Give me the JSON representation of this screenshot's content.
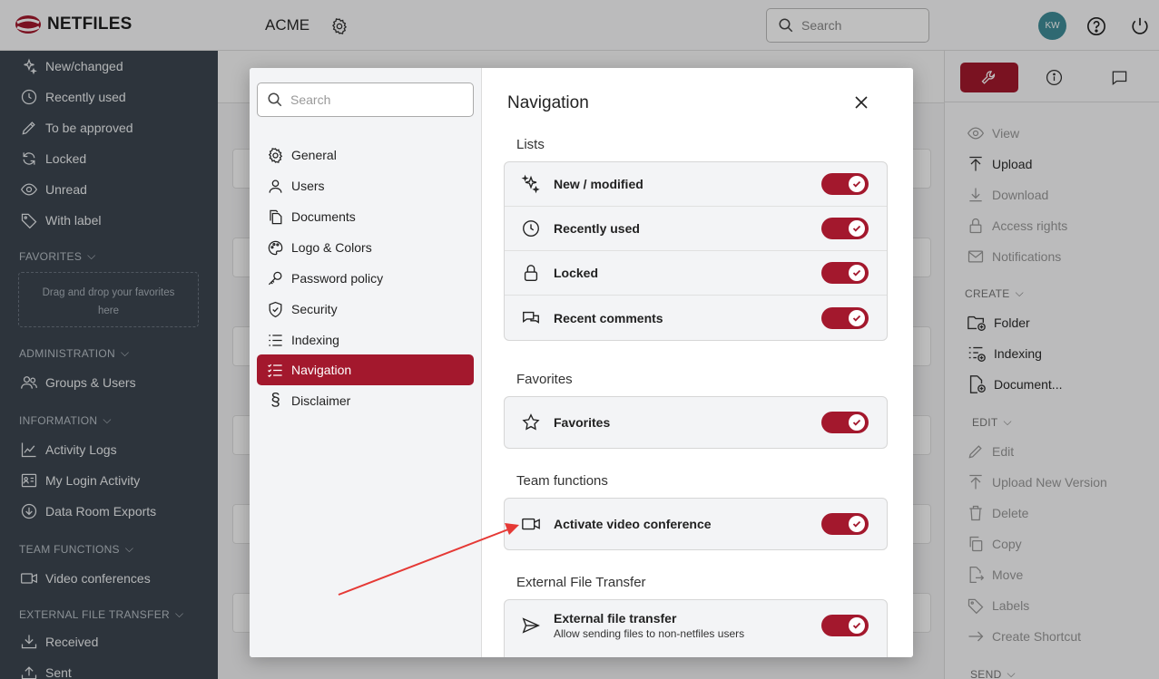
{
  "brand": {
    "name": "NETFILES"
  },
  "header": {
    "room": "ACME",
    "search_placeholder": "Search",
    "avatar_initials": "KW"
  },
  "sidebar": {
    "items": [
      {
        "label": "New/changed",
        "icon": "sparkle-icon"
      },
      {
        "label": "Recently used",
        "icon": "clock-icon"
      },
      {
        "label": "To be approved",
        "icon": "pencil-icon"
      },
      {
        "label": "Locked",
        "icon": "refresh-icon"
      },
      {
        "label": "Unread",
        "icon": "eye-icon"
      },
      {
        "label": "With label",
        "icon": "tag-icon"
      }
    ],
    "favorites_title": "FAVORITES",
    "favorites_drop": "Drag and drop your favorites here",
    "admin_title": "ADMINISTRATION",
    "admin_items": [
      {
        "label": "Groups & Users"
      }
    ],
    "info_title": "INFORMATION",
    "info_items": [
      {
        "label": "Activity Logs"
      },
      {
        "label": "My Login Activity"
      },
      {
        "label": "Data Room Exports"
      }
    ],
    "team_title": "TEAM FUNCTIONS",
    "team_items": [
      {
        "label": "Video conferences"
      }
    ],
    "eft_title": "EXTERNAL FILE TRANSFER",
    "eft_items": [
      {
        "label": "Received"
      },
      {
        "label": "Sent"
      }
    ]
  },
  "right_panel": {
    "items": [
      {
        "label": "View"
      },
      {
        "label": "Upload"
      },
      {
        "label": "Download"
      },
      {
        "label": "Access rights"
      },
      {
        "label": "Notifications"
      }
    ],
    "create_title": "CREATE",
    "create_items": [
      {
        "label": "Folder"
      },
      {
        "label": "Indexing"
      },
      {
        "label": "Document..."
      }
    ],
    "edit_title": "EDIT",
    "edit_items": [
      {
        "label": "Edit"
      },
      {
        "label": "Upload New Version"
      },
      {
        "label": "Delete"
      },
      {
        "label": "Copy"
      },
      {
        "label": "Move"
      },
      {
        "label": "Labels"
      },
      {
        "label": "Create Shortcut"
      }
    ],
    "send_title": "SEND"
  },
  "modal": {
    "search_placeholder": "Search",
    "nav": [
      {
        "label": "General"
      },
      {
        "label": "Users"
      },
      {
        "label": "Documents"
      },
      {
        "label": "Logo & Colors"
      },
      {
        "label": "Password policy"
      },
      {
        "label": "Security"
      },
      {
        "label": "Indexing"
      },
      {
        "label": "Navigation"
      },
      {
        "label": "Disclaimer"
      }
    ],
    "title": "Navigation",
    "groups": {
      "lists": {
        "title": "Lists",
        "rows": [
          {
            "label": "New / modified",
            "on": true
          },
          {
            "label": "Recently used",
            "on": true
          },
          {
            "label": "Locked",
            "on": true
          },
          {
            "label": "Recent comments",
            "on": true
          }
        ]
      },
      "favorites": {
        "title": "Favorites",
        "rows": [
          {
            "label": "Favorites",
            "on": true
          }
        ]
      },
      "team": {
        "title": "Team functions",
        "rows": [
          {
            "label": "Activate video conference",
            "on": true
          }
        ]
      },
      "eft": {
        "title": "External File Transfer",
        "rows": [
          {
            "label": "External file transfer",
            "sub": "Allow sending files to non-netfiles users",
            "on": true
          }
        ]
      }
    }
  },
  "colors": {
    "accent": "#a3182d",
    "sidebar_bg": "#3c4651",
    "annotation_arrow": "#e53935"
  }
}
